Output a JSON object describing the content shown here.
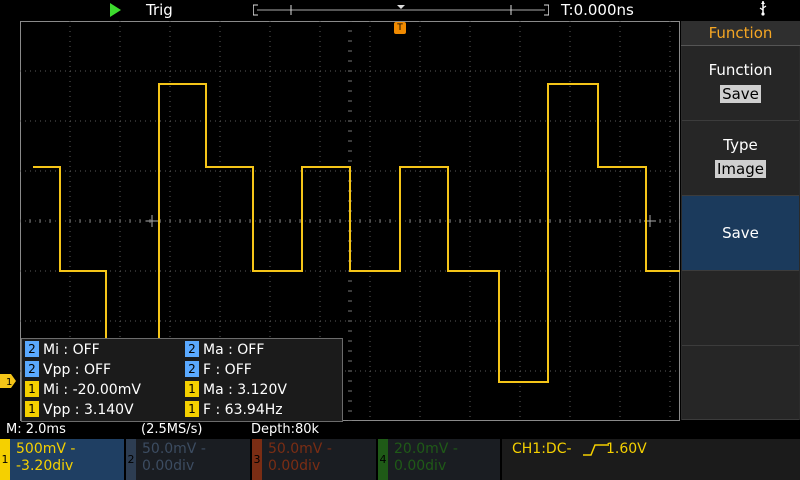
{
  "top": {
    "run_state": "Trig",
    "time_offset": "T:0.000ns",
    "trigger_marker": "T",
    "ch1_marker": "1"
  },
  "icons": {
    "run": "play-icon",
    "usb": "usb-icon"
  },
  "colors": {
    "ch1": "#f5d000",
    "ch2": "#5aa9ff",
    "ch3": "#d9552a",
    "ch4": "#3aa52a",
    "accent": "#f5a623"
  },
  "menu": {
    "title": "Function",
    "items": [
      {
        "label": "Function",
        "value": "Save"
      },
      {
        "label": "Type",
        "value": "Image"
      },
      {
        "label": "Save"
      }
    ]
  },
  "measurements": [
    {
      "ch": "2",
      "text": "Mi : OFF"
    },
    {
      "ch": "2",
      "text": "Ma : OFF"
    },
    {
      "ch": "2",
      "text": "Vpp : OFF"
    },
    {
      "ch": "2",
      "text": "F : OFF"
    },
    {
      "ch": "1",
      "text": "Mi : -20.00mV"
    },
    {
      "ch": "1",
      "text": "Ma : 3.120V"
    },
    {
      "ch": "1",
      "text": "Vpp : 3.140V"
    },
    {
      "ch": "1",
      "text": "F : 63.94Hz"
    }
  ],
  "status": {
    "timebase": "M: 2.0ms",
    "sample_rate": "(2.5MS/s)",
    "depth": "Depth:80k"
  },
  "channels": [
    {
      "num": "1",
      "scale": "500mV -",
      "offset": "-3.20div"
    },
    {
      "num": "2",
      "scale": "50.0mV -",
      "offset": "0.00div"
    },
    {
      "num": "3",
      "scale": "50.0mV -",
      "offset": "0.00div"
    },
    {
      "num": "4",
      "scale": "20.0mV -",
      "offset": "0.00div"
    }
  ],
  "trigger_info": {
    "source": "CH1:DC-",
    "level": "1.60V"
  }
}
